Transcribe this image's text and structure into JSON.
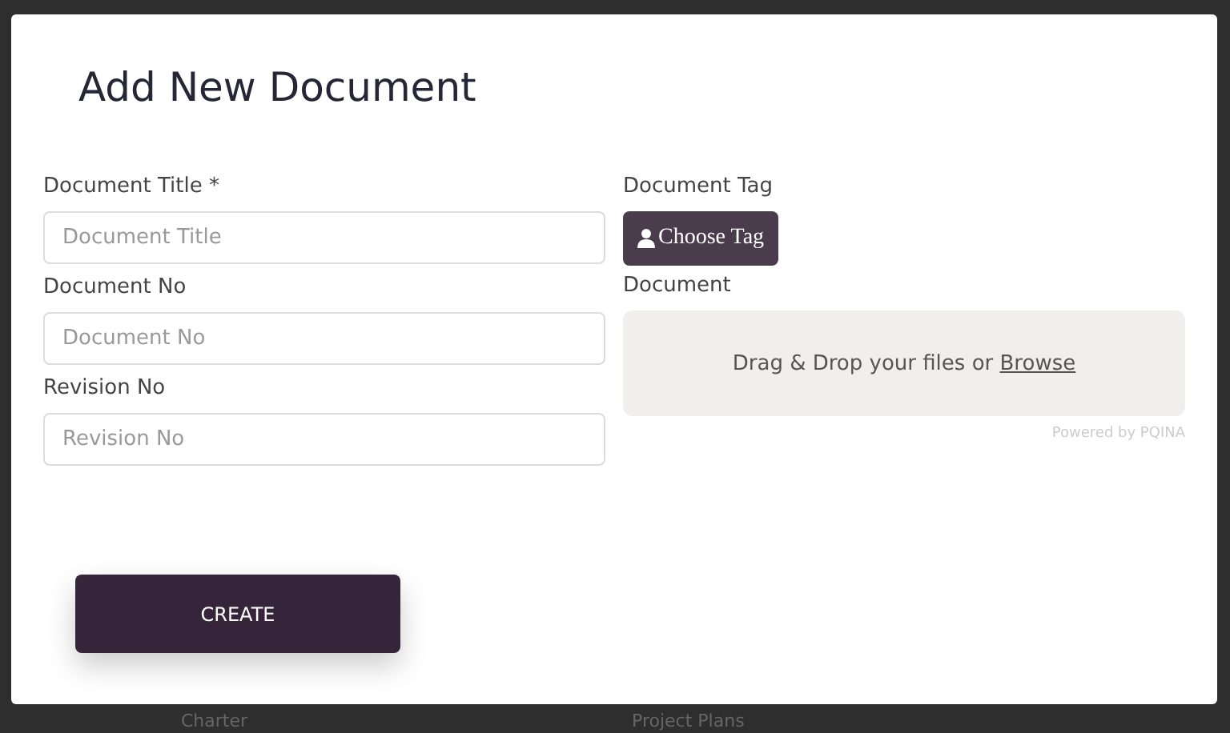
{
  "dialog": {
    "title": "Add New Document"
  },
  "fields": [
    {
      "label": "Document Title *",
      "placeholder": "Document Title"
    },
    {
      "label": "Document No",
      "placeholder": "Document No"
    },
    {
      "label": "Revision No",
      "placeholder": "Revision No"
    }
  ],
  "tag": {
    "label": "Document Tag",
    "button": "Choose Tag"
  },
  "upload": {
    "label": "Document",
    "prompt": "Drag & Drop your files or ",
    "link": "Browse",
    "credit": "Powered by PQINA"
  },
  "submit": "CREATE",
  "background": {
    "items": [
      "Charter",
      "Project Plans"
    ]
  }
}
